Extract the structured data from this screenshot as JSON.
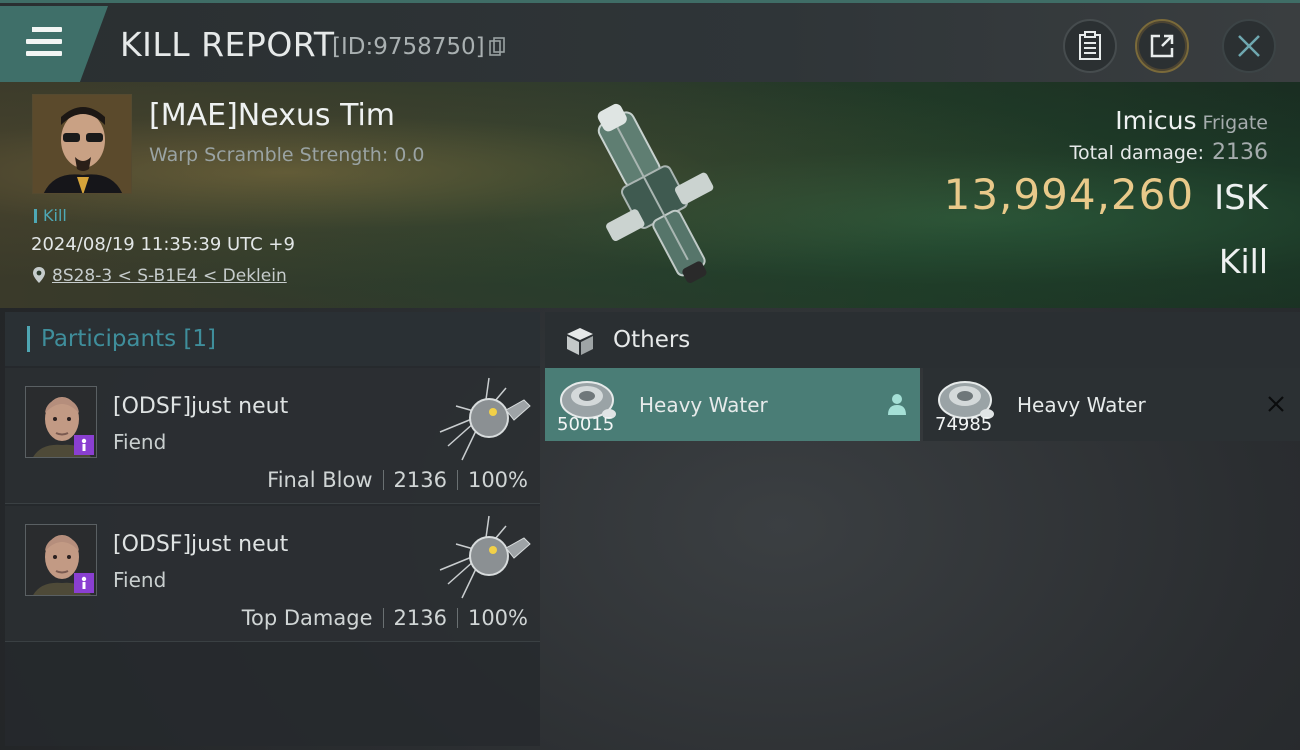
{
  "header": {
    "title": "KILL REPORT",
    "report_id": "[ID:9758750]"
  },
  "victim": {
    "name": "[MAE]Nexus Tim",
    "warp_scramble": "Warp Scramble Strength: 0.0",
    "tag": "Kill",
    "datetime": "2024/08/19 11:35:39 UTC +9",
    "location": "8S28-3 < S-B1E4 < Deklein",
    "ship_name": "Imicus",
    "ship_class": "Frigate",
    "total_damage_label": "Total damage:",
    "total_damage_value": "2136",
    "isk_value": "13,994,260",
    "isk_unit": "ISK",
    "result": "Kill"
  },
  "participants": {
    "heading": "Participants [1]",
    "rows": [
      {
        "name": "[ODSF]just neut",
        "ship": "Fiend",
        "role": "Final Blow",
        "damage": "2136",
        "percent": "100%"
      },
      {
        "name": "[ODSF]just neut",
        "ship": "Fiend",
        "role": "Top Damage",
        "damage": "2136",
        "percent": "100%"
      }
    ]
  },
  "others": {
    "heading": "Others",
    "items": [
      {
        "name": "Heavy Water",
        "qty": "50015",
        "state": "dropped"
      },
      {
        "name": "Heavy Water",
        "qty": "74985",
        "state": "destroyed"
      }
    ]
  },
  "colors": {
    "accent": "#4fa6b3",
    "isk_gold": "#e9c98a",
    "active_item": "#4a7d76",
    "badge_purple": "#8a3fd1"
  },
  "icons": [
    "menu-icon",
    "copy-icon",
    "clipboard-icon",
    "share-icon",
    "close-icon",
    "location-pin-icon",
    "cube-icon",
    "person-icon",
    "x-icon"
  ]
}
